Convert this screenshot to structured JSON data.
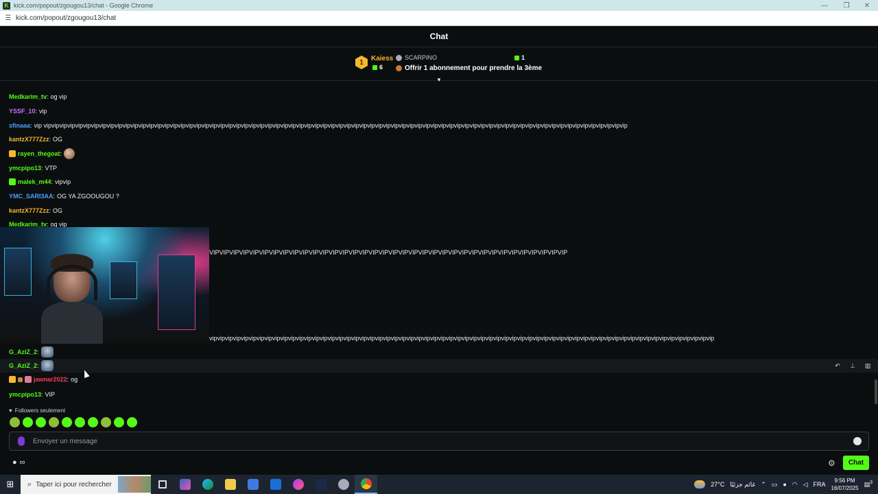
{
  "window": {
    "title": "kick.com/popout/zgougou13/chat - Google Chrome",
    "url": "kick.com/popout/zgougou13/chat",
    "minimize": "—",
    "restore": "❐",
    "close": "✕"
  },
  "header": {
    "title": "Chat"
  },
  "pinned": {
    "rank": "1",
    "leader_name": "Kaiess",
    "leader_count": "6",
    "giver_name": "SCARPINO",
    "giver_count": "1",
    "offer_text": "Offrir 1 abonnement pour prendre la 3ème",
    "toggle_icon": "▾"
  },
  "messages": [
    {
      "user": "Medkarim_tv",
      "color": "#53fc18",
      "text": "og vip"
    },
    {
      "user": "YSSF_10",
      "color": "#c770ff",
      "text": "vip"
    },
    {
      "user": "sfinaaa",
      "color": "#4a9fff",
      "text": "vip vipvipvipvipvipvipvipvipvipvipvipvipvipvipvipvipvipvipvipvipvipvipvipvipvipvipvipvipvipvipvipvipvipvipvipvipvipvipvipvipvipvipvipvipvipvipvipvipvipvipvipvipvipvipvipvipvipvipvipvipvipvipvipvipvipvipvipvipvipvipvipvipvipvip"
    },
    {
      "user": "kantzX777Zzz",
      "color": "#f5b82e",
      "text": "OG"
    },
    {
      "user": "rayen_thegoat",
      "color": "#53fc18",
      "text": ""
    },
    {
      "user": "ymcpipo13",
      "color": "#53fc18",
      "text": "VTP"
    },
    {
      "user": "malek_m44",
      "color": "#53fc18",
      "text": "vipvip"
    },
    {
      "user": "YMC_SARI3AA",
      "color": "#4a9fff",
      "text": "OG YA ZGOOUGOU ?"
    },
    {
      "user": "kantzX777Zzz",
      "color": "#f5b82e",
      "text": "OG"
    },
    {
      "user": "Medkarim_tv",
      "color": "#53fc18",
      "text": "og vip"
    },
    {
      "user": "",
      "color": "#ffffff",
      "text": "VIPVIPVIPVIPVIPVIPVIPVIPVIPVIPVIPVIPVIPVIPVIPVIPVIPVIPVIPVIPVIPVIPVIPVIPVIPVIPVIPVIPVIPVIPVIPVIPVIPVIPVIPVIP"
    },
    {
      "user": "",
      "color": "#ffffff",
      "text": "vipvipvipvipvipvipvipvipvipvipvipvipvipvipvipvipvipvipvipvipvipvipvipvipvipvipvipvipvipvipvipvipvipvipvipvipvipvipvipvipvipvipvipvipvipvipvipvipvipvipvipvipvipvipvipvipvipvipvipvipvipvipvipvip"
    },
    {
      "user": "G_AziZ_2",
      "color": "#53fc18",
      "text": ""
    },
    {
      "user": "G_AziZ_2",
      "color": "#53fc18",
      "text": ""
    },
    {
      "user": "jawnar2022",
      "color": "#ff3b5c",
      "text": "og"
    },
    {
      "user": "ymcpipo13",
      "color": "#53fc18",
      "text": "VIP"
    }
  ],
  "composer": {
    "followers_only": "Followers seulement",
    "placeholder": "Envoyer un message",
    "send_label": "Chat",
    "gear_icon": "⚙",
    "bottom_left": "∞"
  },
  "taskbar": {
    "search_placeholder": "Taper ici pour rechercher",
    "weather": "27°C",
    "weather_text": "غائم جزئيًا",
    "lang": "FRA",
    "time": "9:56 PM",
    "date": "16/07/2025",
    "notif_count": "3"
  },
  "colors": {
    "accent": "#53fc18",
    "background": "#0b0e0f"
  }
}
